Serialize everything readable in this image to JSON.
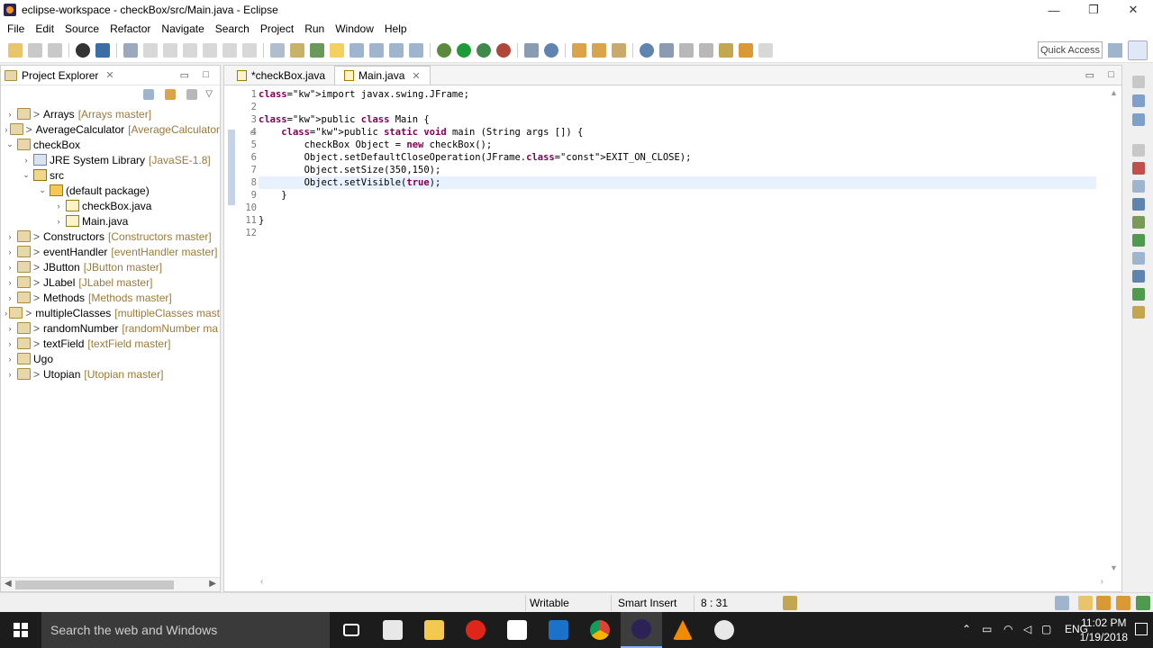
{
  "window": {
    "title": "eclipse-workspace - checkBox/src/Main.java - Eclipse",
    "minimize": "—",
    "maximize": "❐",
    "close": "✕"
  },
  "menu": [
    "File",
    "Edit",
    "Source",
    "Refactor",
    "Navigate",
    "Search",
    "Project",
    "Run",
    "Window",
    "Help"
  ],
  "toolbar": {
    "quick_access": "Quick Access"
  },
  "project_explorer": {
    "title": "Project Explorer",
    "close": "✕",
    "tree": [
      {
        "indent": 0,
        "twisty": "›",
        "icon": "project",
        "prefix": ">",
        "name": "Arrays",
        "repo": "[Arrays master]"
      },
      {
        "indent": 0,
        "twisty": "›",
        "icon": "project",
        "prefix": ">",
        "name": "AverageCalculator",
        "repo": "[AverageCalculator"
      },
      {
        "indent": 0,
        "twisty": "⌄",
        "icon": "project",
        "prefix": "",
        "name": "checkBox",
        "repo": ""
      },
      {
        "indent": 1,
        "twisty": "›",
        "icon": "jre",
        "prefix": "",
        "name": "JRE System Library",
        "repo": "[JavaSE-1.8]"
      },
      {
        "indent": 1,
        "twisty": "⌄",
        "icon": "src",
        "prefix": "",
        "name": "src",
        "repo": ""
      },
      {
        "indent": 2,
        "twisty": "⌄",
        "icon": "package",
        "prefix": "",
        "name": "(default package)",
        "repo": ""
      },
      {
        "indent": 3,
        "twisty": "›",
        "icon": "java",
        "prefix": "",
        "name": "checkBox.java",
        "repo": ""
      },
      {
        "indent": 3,
        "twisty": "›",
        "icon": "java",
        "prefix": "",
        "name": "Main.java",
        "repo": ""
      },
      {
        "indent": 0,
        "twisty": "›",
        "icon": "project",
        "prefix": ">",
        "name": "Constructors",
        "repo": "[Constructors master]"
      },
      {
        "indent": 0,
        "twisty": "›",
        "icon": "project",
        "prefix": ">",
        "name": "eventHandler",
        "repo": "[eventHandler master]"
      },
      {
        "indent": 0,
        "twisty": "›",
        "icon": "project",
        "prefix": ">",
        "name": "JButton",
        "repo": "[JButton master]"
      },
      {
        "indent": 0,
        "twisty": "›",
        "icon": "project",
        "prefix": ">",
        "name": "JLabel",
        "repo": "[JLabel master]"
      },
      {
        "indent": 0,
        "twisty": "›",
        "icon": "project",
        "prefix": ">",
        "name": "Methods",
        "repo": "[Methods master]"
      },
      {
        "indent": 0,
        "twisty": "›",
        "icon": "project",
        "prefix": ">",
        "name": "multipleClasses",
        "repo": "[multipleClasses mast"
      },
      {
        "indent": 0,
        "twisty": "›",
        "icon": "project",
        "prefix": ">",
        "name": "randomNumber",
        "repo": "[randomNumber ma"
      },
      {
        "indent": 0,
        "twisty": "›",
        "icon": "project",
        "prefix": ">",
        "name": "textField",
        "repo": "[textField master]"
      },
      {
        "indent": 0,
        "twisty": "›",
        "icon": "project",
        "prefix": "",
        "name": "Ugo",
        "repo": ""
      },
      {
        "indent": 0,
        "twisty": "›",
        "icon": "project",
        "prefix": ">",
        "name": "Utopian",
        "repo": "[Utopian master]"
      }
    ]
  },
  "editor": {
    "tabs": [
      {
        "label": "*checkBox.java",
        "active": false
      },
      {
        "label": "Main.java",
        "active": true
      }
    ],
    "lines": [
      {
        "n": "1",
        "code": "import javax.swing.JFrame;"
      },
      {
        "n": "2",
        "code": ""
      },
      {
        "n": "3",
        "code": "public class Main {"
      },
      {
        "n": "4",
        "code": "    public static void main (String args []) {"
      },
      {
        "n": "5",
        "code": "        checkBox Object = new checkBox();"
      },
      {
        "n": "6",
        "code": "        Object.setDefaultCloseOperation(JFrame.EXIT_ON_CLOSE);"
      },
      {
        "n": "7",
        "code": "        Object.setSize(350,150);"
      },
      {
        "n": "8",
        "code": "        Object.setVisible(true);"
      },
      {
        "n": "9",
        "code": "    }"
      },
      {
        "n": "10",
        "code": ""
      },
      {
        "n": "11",
        "code": "}"
      },
      {
        "n": "12",
        "code": ""
      }
    ],
    "current_line": 8
  },
  "status": {
    "writable": "Writable",
    "insert_mode": "Smart Insert",
    "position": "8 : 31"
  },
  "taskbar": {
    "search_placeholder": "Search the web and Windows",
    "language": "ENG",
    "time": "11:02 PM",
    "date": "1/19/2018"
  },
  "colors": {
    "keyword": "#7f0055",
    "constant": "#0000c0",
    "current_line": "#e8f2fe",
    "repo_label": "#9b7a39"
  }
}
